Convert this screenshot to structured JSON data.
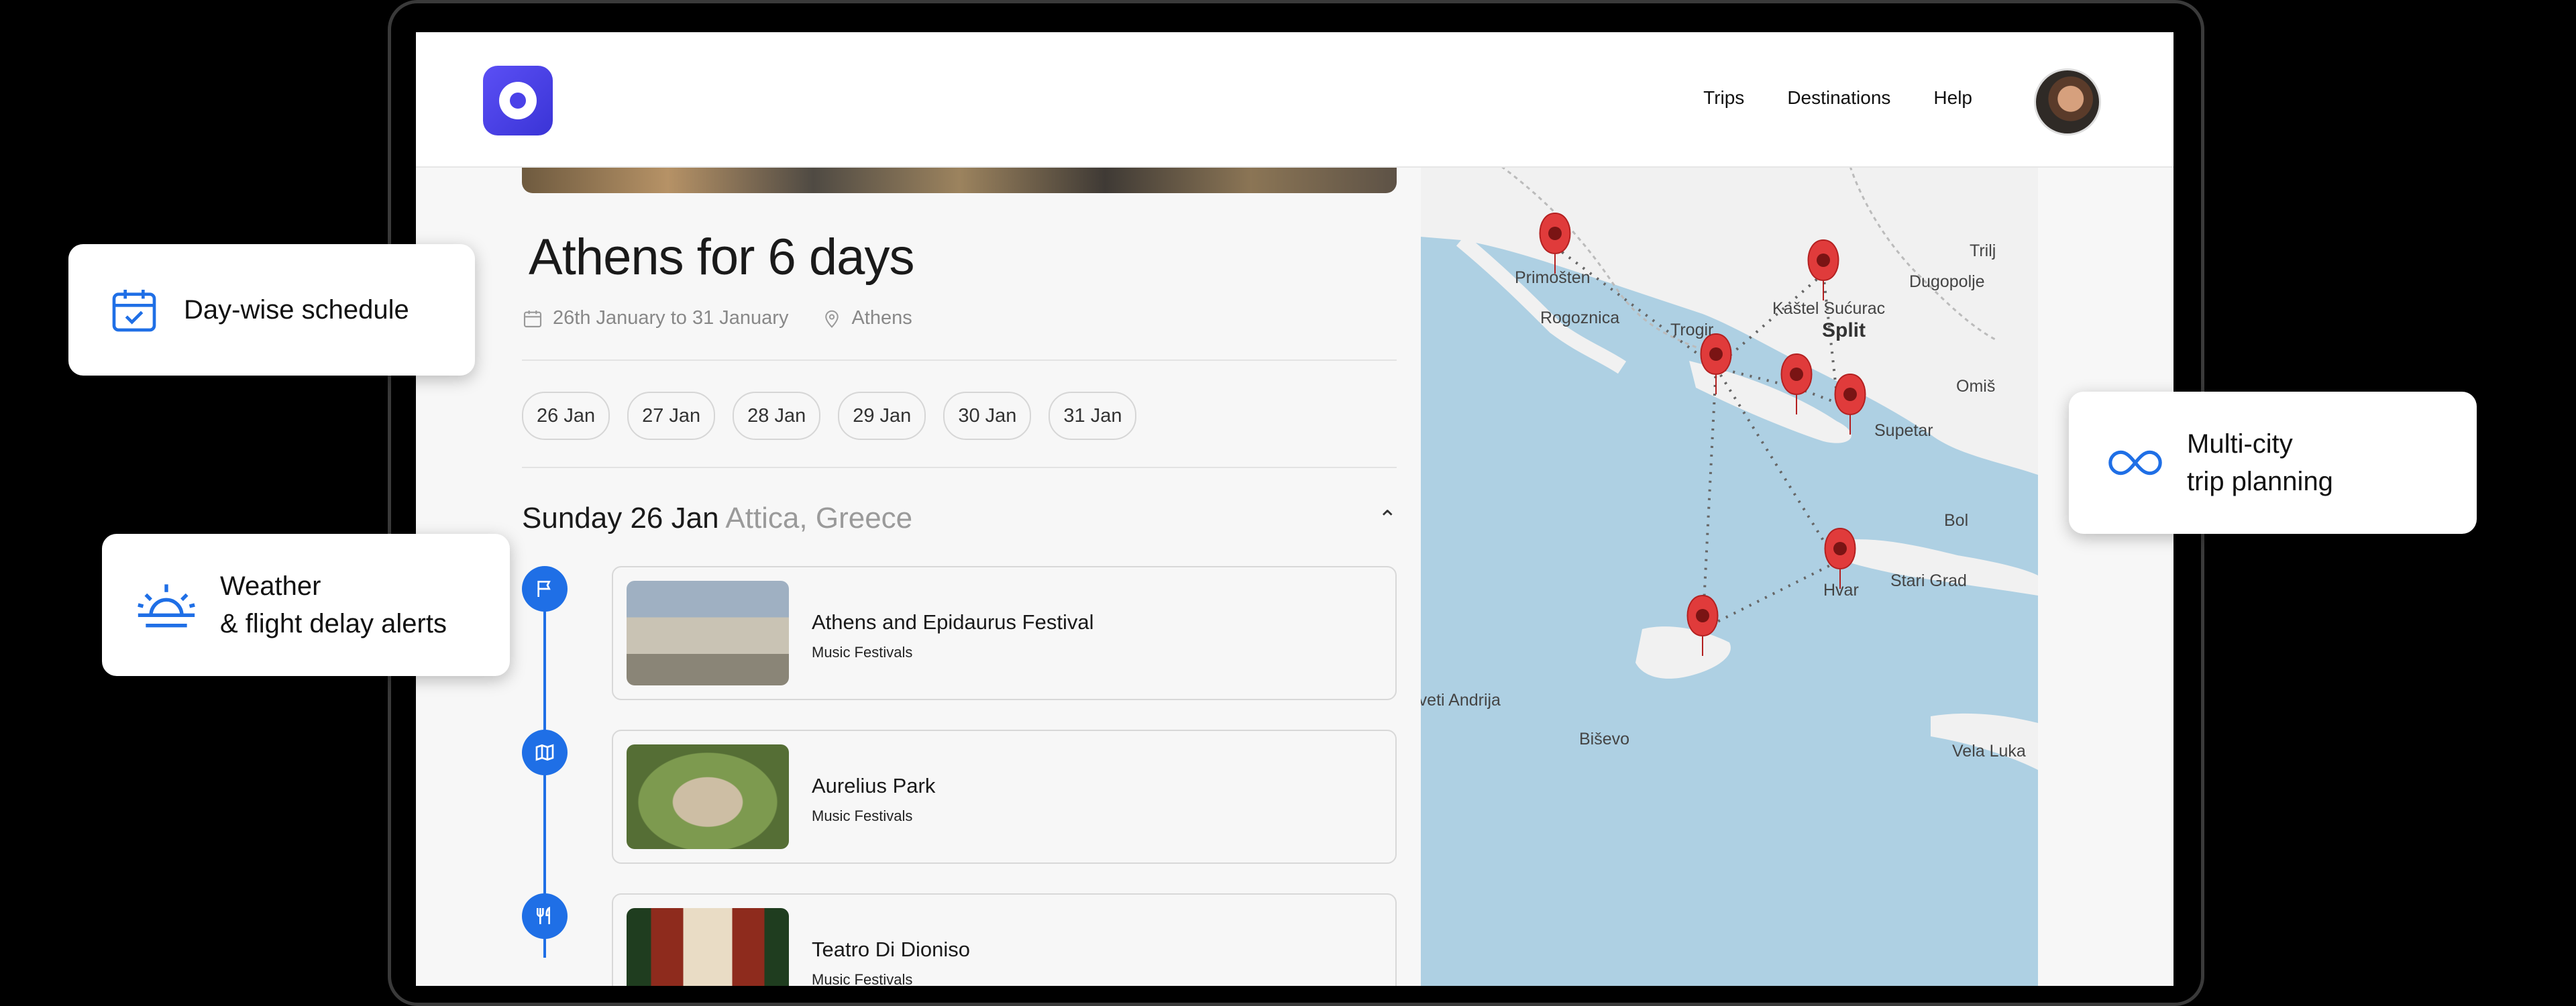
{
  "header": {
    "nav": [
      "Trips",
      "Destinations",
      "Help"
    ]
  },
  "trip": {
    "title": "Athens for 6 days",
    "dates": "26th January to 31 January",
    "location": "Athens"
  },
  "day_chips": [
    "26 Jan",
    "27 Jan",
    "28 Jan",
    "29 Jan",
    "30 Jan",
    "31 Jan"
  ],
  "day_section": {
    "day": "Sunday 26 Jan",
    "region": "Attica, Greece"
  },
  "itinerary": [
    {
      "name": "Athens and Epidaurus Festival",
      "category": "Music Festivals",
      "icon": "flag-icon"
    },
    {
      "name": "Aurelius Park",
      "category": "Music Festivals",
      "icon": "map-icon"
    },
    {
      "name": "Teatro Di Dioniso",
      "category": "Music Festivals",
      "icon": "fork-knife-icon"
    }
  ],
  "map": {
    "labels": [
      "Trilj",
      "Primošten",
      "Dugopolje",
      "Kaštel Sućurac",
      "Rogoznica",
      "Trogir",
      "Split",
      "Omiš",
      "Supetar",
      "Bol",
      "Stari Grad",
      "Hvar",
      "Sveti Andrija",
      "Biševo",
      "Vela Luka"
    ]
  },
  "features": {
    "schedule": "Day-wise schedule",
    "weather_line1": "Weather",
    "weather_line2": "& flight delay alerts",
    "multicity_line1": "Multi-city",
    "multicity_line2": "trip planning"
  },
  "colors": {
    "accent": "#1f6fe6",
    "brand": "#4a41e8",
    "pin": "#e03b3b"
  }
}
